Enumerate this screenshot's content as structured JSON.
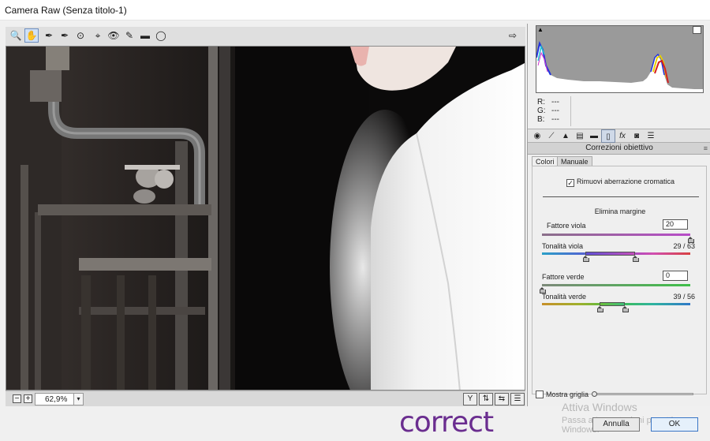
{
  "window": {
    "title": "Camera Raw (Senza titolo-1)"
  },
  "toolbar": {
    "tools": [
      {
        "name": "zoom-tool",
        "glyph": "🔍"
      },
      {
        "name": "hand-tool",
        "glyph": "✋"
      },
      {
        "name": "white-balance-tool",
        "glyph": "✒"
      },
      {
        "name": "color-sampler-tool",
        "glyph": "✒"
      },
      {
        "name": "targeted-adjustment-tool",
        "glyph": "⊙"
      },
      {
        "name": "spot-removal-tool",
        "glyph": "⌖"
      },
      {
        "name": "red-eye-tool",
        "glyph": "👁"
      },
      {
        "name": "adjustment-brush-tool",
        "glyph": "✎"
      },
      {
        "name": "graduated-filter-tool",
        "glyph": "▬"
      },
      {
        "name": "radial-filter-tool",
        "glyph": "◯"
      }
    ],
    "export_glyph": "⇨"
  },
  "bottom_bar": {
    "zoom_minus": "−",
    "zoom_plus": "+",
    "zoom_value": "62,9%",
    "zoom_drop": "▾",
    "view_buttons": [
      "Y",
      "⇅",
      "⇆",
      "☰"
    ]
  },
  "info": {
    "r_label": "R:",
    "r_value": "---",
    "g_label": "G:",
    "g_value": "---",
    "b_label": "B:",
    "b_value": "---"
  },
  "panel": {
    "title": "Correzioni obiettivo",
    "menu_glyph": "≡",
    "tabs": [
      "Colori",
      "Manuale"
    ],
    "checkbox_label": "Rimuovi aberrazione cromatica",
    "checkbox_checked": true,
    "section_title": "Elimina margine",
    "sliders": {
      "fattore_viola": {
        "label": "Fattore viola",
        "value": "20",
        "fraction": 1.0
      },
      "tonalita_viola": {
        "label": "Tonalità viola",
        "value": "29 / 63",
        "low": 29,
        "high": 63,
        "max": 100
      },
      "fattore_verde": {
        "label": "Fattore verde",
        "value": "0",
        "fraction": 0.0
      },
      "tonalita_verde": {
        "label": "Tonalità verde",
        "value": "39 / 56",
        "low": 39,
        "high": 56,
        "max": 100
      }
    },
    "grid_label": "Mostra griglia"
  },
  "watermark": {
    "title": "Attiva Windows",
    "subtitle": "Passa a Impostazioni per attivare Windows."
  },
  "buttons": {
    "cancel": "Annulla",
    "ok": "OK"
  },
  "annotation": "correct",
  "colors": {
    "accent": "#3a76c5",
    "annotation": "#6a2d8f"
  }
}
